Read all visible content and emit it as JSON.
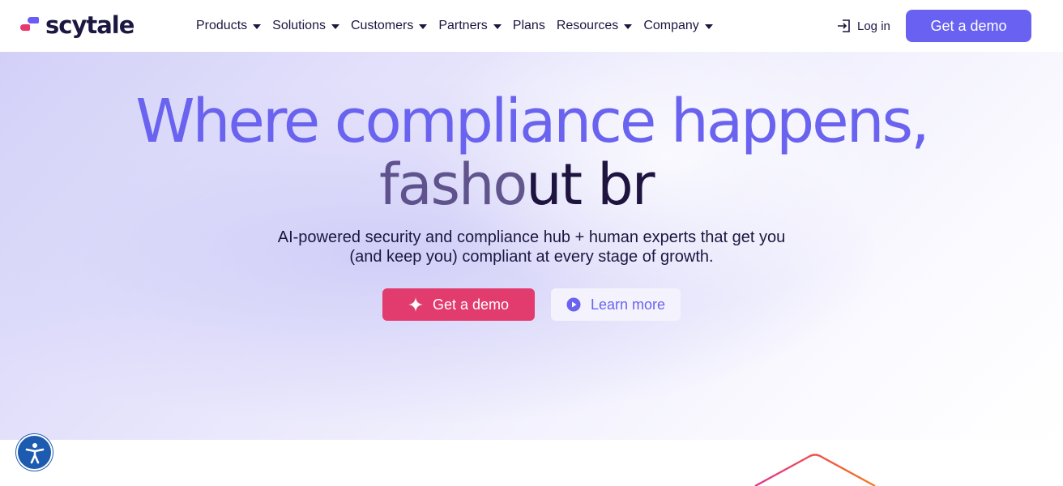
{
  "header": {
    "logo_text": "scytale",
    "nav": [
      {
        "label": "Products",
        "has_dropdown": true
      },
      {
        "label": "Solutions",
        "has_dropdown": true
      },
      {
        "label": "Customers",
        "has_dropdown": true
      },
      {
        "label": "Partners",
        "has_dropdown": true
      },
      {
        "label": "Plans",
        "has_dropdown": false
      },
      {
        "label": "Resources",
        "has_dropdown": true
      },
      {
        "label": "Company",
        "has_dropdown": true
      }
    ],
    "login_label": "Log in",
    "demo_label": "Get a demo"
  },
  "hero": {
    "headline": "Where compliance happens,",
    "typed_ghost": "fasho",
    "typed_solid": "ut br",
    "subtitle_line1": "AI-powered security and compliance hub + human experts that get you",
    "subtitle_line2": "(and keep you) compliant at every stage of growth.",
    "primary_cta": "Get a demo",
    "secondary_cta": "Learn more"
  },
  "colors": {
    "brand_purple": "#6861f2",
    "cta_pink": "#e23b6e",
    "heading_purple": "#6a63ef",
    "text_dark": "#1c1740",
    "accessibility_blue": "#1d5bb0"
  },
  "icons": {
    "login": "login-icon",
    "sparkle": "sparkle-icon",
    "play": "play-circle-icon",
    "accessibility": "accessibility-icon",
    "caret": "chevron-down-icon"
  }
}
